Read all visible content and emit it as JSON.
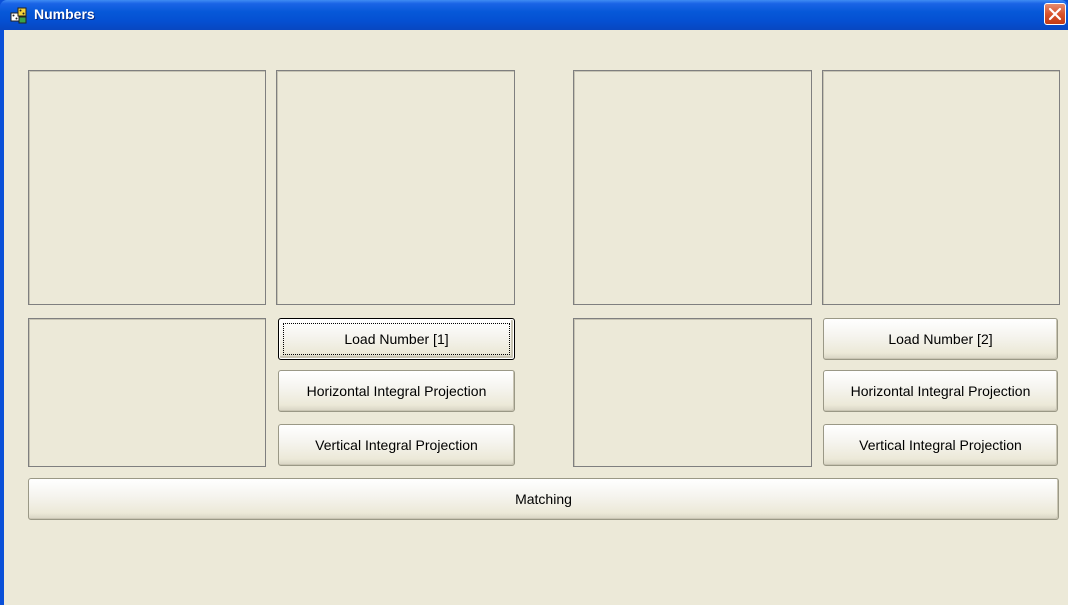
{
  "window": {
    "title": "Numbers",
    "app_icon": "dice-app-icon",
    "close_icon": "close-x-icon"
  },
  "left": {
    "load_label": "Load Number [1]",
    "horizontal_label": "Horizontal Integral Projection",
    "vertical_label": "Vertical Integral Projection"
  },
  "right": {
    "load_label": "Load Number [2]",
    "horizontal_label": "Horizontal Integral Projection",
    "vertical_label": "Vertical Integral Projection"
  },
  "matching_label": "Matching",
  "colors": {
    "titlebar": "#0658d8",
    "client": "#ece9d8",
    "close_button": "#d9532c"
  }
}
